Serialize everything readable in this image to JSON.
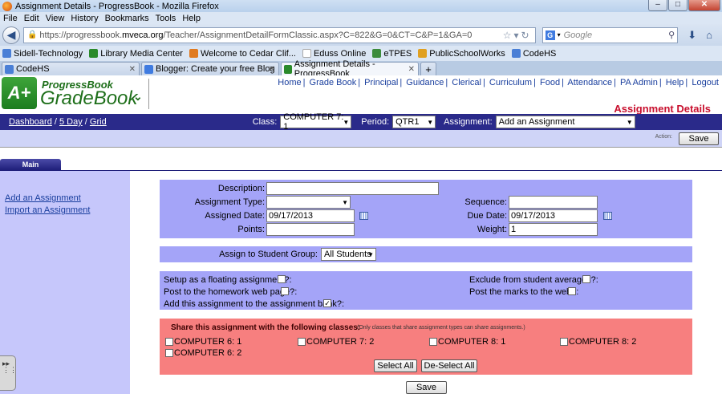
{
  "window": {
    "title": "Assignment Details - ProgressBook - Mozilla Firefox",
    "controls": [
      "–",
      "□",
      "✕"
    ]
  },
  "menu": [
    "File",
    "Edit",
    "View",
    "History",
    "Bookmarks",
    "Tools",
    "Help"
  ],
  "url": {
    "prefix": "https://progressbook.",
    "domain": "mveca.org",
    "path": "/Teacher/AssignmentDetailFormClassic.aspx?C=822&G=0&CT=C&P=1&GA=0"
  },
  "search": {
    "engine": "G",
    "placeholder": "Google"
  },
  "bookmarks": [
    {
      "label": "Sidell-Technology",
      "color": "#4a7fd6"
    },
    {
      "label": "Library Media Center",
      "color": "#2a8a2a"
    },
    {
      "label": "Welcome to Cedar Clif...",
      "color": "#e07a1f"
    },
    {
      "label": "Eduss Online",
      "color": "#cccccc"
    },
    {
      "label": "eTPES",
      "color": "#3c8c3c"
    },
    {
      "label": "PublicSchoolWorks",
      "color": "#e0a020"
    },
    {
      "label": "CodeHS",
      "color": "#4a7fd6"
    }
  ],
  "tabs": [
    {
      "label": "CodeHS",
      "color": "#4a7fd6"
    },
    {
      "label": "Blogger: Create your free Blog",
      "color": "#3f7be0"
    },
    {
      "label": "Assignment Details - ProgressBook",
      "color": "#2a8a2a"
    }
  ],
  "brand": {
    "logo": "A+",
    "small": "ProgressBook",
    "big": "GradeBook",
    "chevron": "⌄"
  },
  "toplinks": [
    "Home",
    "Grade Book",
    "Principal",
    "Guidance",
    "Clerical",
    "Curriculum",
    "Food",
    "Attendance",
    "PA Admin",
    "Help",
    "Logout"
  ],
  "page_title": "Assignment Details",
  "crumbs": [
    "Dashboard",
    "5 Day",
    "Grid"
  ],
  "filters": {
    "class_label": "Class:",
    "class_value": "COMPUTER 7: 1",
    "period_label": "Period:",
    "period_value": "QTR1",
    "assignment_label": "Assignment:",
    "assignment_value": "Add an Assignment"
  },
  "action": {
    "label": "Action:",
    "save": "Save"
  },
  "main_tab": "Main",
  "left_links": [
    "Add an Assignment",
    "Import an Assignment"
  ],
  "form": {
    "description_label": "Description:",
    "description_value": "",
    "type_label": "Assignment Type:",
    "type_value": "",
    "sequence_label": "Sequence:",
    "sequence_value": "",
    "assigned_label": "Assigned Date:",
    "assigned_value": "09/17/2013",
    "due_label": "Due Date:",
    "due_value": "09/17/2013",
    "points_label": "Points:",
    "points_value": "",
    "weight_label": "Weight:",
    "weight_value": "1"
  },
  "group": {
    "label": "Assign to Student Group:",
    "value": "All Students"
  },
  "options": {
    "floating": {
      "label": "Setup as a floating assignment?:",
      "checked": false
    },
    "exclude": {
      "label": "Exclude from student averages?:",
      "checked": false
    },
    "homework": {
      "label": "Post to the homework web page?:",
      "checked": false
    },
    "marks": {
      "label": "Post the marks to the web?:",
      "checked": false
    },
    "bank": {
      "label": "Add this assignment to the assignment bank?:",
      "checked": true
    }
  },
  "share": {
    "title": "Share this assignment with the following classes:",
    "note": "(Only classes that share assignment types can share assignments.)",
    "classes": [
      "COMPUTER 6: 1",
      "COMPUTER 7: 2",
      "COMPUTER 8: 1",
      "COMPUTER 8: 2",
      "COMPUTER 6: 2"
    ],
    "select_all": "Select All",
    "deselect_all": "De-Select All"
  },
  "bottom_save": "Save",
  "icons": {
    "back": "◀",
    "check": "✓",
    "arrow": "▼",
    "plus": "+",
    "close": "✕"
  }
}
